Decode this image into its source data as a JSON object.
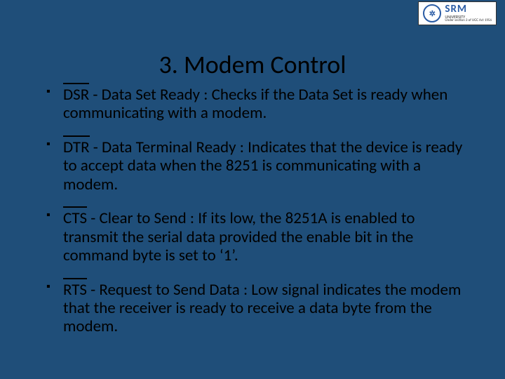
{
  "logo": {
    "mark": "✲",
    "main": "SRM",
    "sub": "UNIVERSITY",
    "tag": "Under section 3 of UGC Act 1956"
  },
  "title": "3. Modem Control",
  "bullets": [
    {
      "sig": "DSR",
      "rest": " - Data Set Ready : Checks if the Data Set is ready when communicating with a modem."
    },
    {
      "sig": "DTR",
      "rest": " - Data Terminal Ready : Indicates that the device is ready to accept data when the 8251 is communicating with a modem."
    },
    {
      "sig": "CTS",
      "rest": " - Clear to Send :  If its low, the 8251A is enabled to transmit the serial data provided the enable bit in the command byte is set to ‘1’."
    },
    {
      "sig": "RTS",
      "rest": " - Request to Send Data : Low signal indicates the modem that the receiver is ready to receive a data byte from the modem."
    }
  ]
}
